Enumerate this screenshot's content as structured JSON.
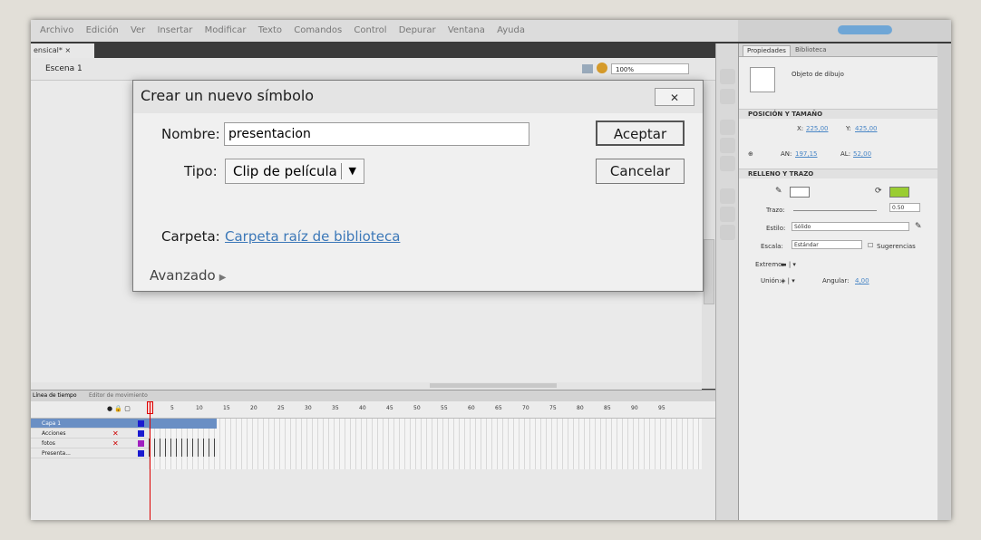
{
  "document_tab": "ensical* ×",
  "menubar": [
    "Archivo",
    "Edición",
    "Ver",
    "Insertar",
    "Modificar",
    "Texto",
    "Comandos",
    "Control",
    "Depurar",
    "Ventana",
    "Ayuda"
  ],
  "stage": {
    "scene_label": "Escena 1",
    "zoom": "100%"
  },
  "dialog": {
    "title": "Crear un nuevo símbolo",
    "close_label": "✕",
    "name_label": "Nombre:",
    "name_value": "presentacion",
    "type_label": "Tipo:",
    "type_value": "Clip de película",
    "folder_label": "Carpeta:",
    "folder_value": "Carpeta raíz de biblioteca",
    "ok_label": "Aceptar",
    "cancel_label": "Cancelar",
    "advanced_label": "Avanzado"
  },
  "properties": {
    "tab_props": "Propiedades",
    "tab_lib": "Biblioteca",
    "object_type": "Objeto de dibujo",
    "section_pos": "POSICIÓN Y TAMAÑO",
    "x_label": "X:",
    "x_value": "225,00",
    "y_label": "Y:",
    "y_value": "425,00",
    "w_label": "AN:",
    "w_value": "197,15",
    "h_label": "AL:",
    "h_value": "52,00",
    "section_fill": "RELLENO Y TRAZO",
    "stroke_label": "Trazo:",
    "stroke_value": "0.50",
    "style_label": "Estilo:",
    "style_value": "Sólido",
    "scale_label": "Escala:",
    "scale_value": "Estándar",
    "hint_label": "Sugerencias",
    "cap_label": "Extremo:",
    "join_label": "Unión:",
    "angular_label": "Angular:",
    "angular_value": "4,00",
    "stroke_color": "#ffffff",
    "fill_color": "#9acd32"
  },
  "timeline": {
    "tab_timeline": "Línea de tiempo",
    "tab_motion": "Editor de movimiento",
    "frame_numbers": [
      "5",
      "10",
      "15",
      "20",
      "25",
      "30",
      "35",
      "40",
      "45",
      "50",
      "55",
      "60",
      "65",
      "70",
      "75",
      "80",
      "85",
      "90",
      "95"
    ],
    "layers": [
      {
        "name": "Capa 1",
        "color": "#1a1ad0"
      },
      {
        "name": "Acciones",
        "color": "#1a1ad0"
      },
      {
        "name": "fotos",
        "color": "#a020c0"
      },
      {
        "name": "Presenta...",
        "color": "#1a1ad0"
      }
    ]
  }
}
